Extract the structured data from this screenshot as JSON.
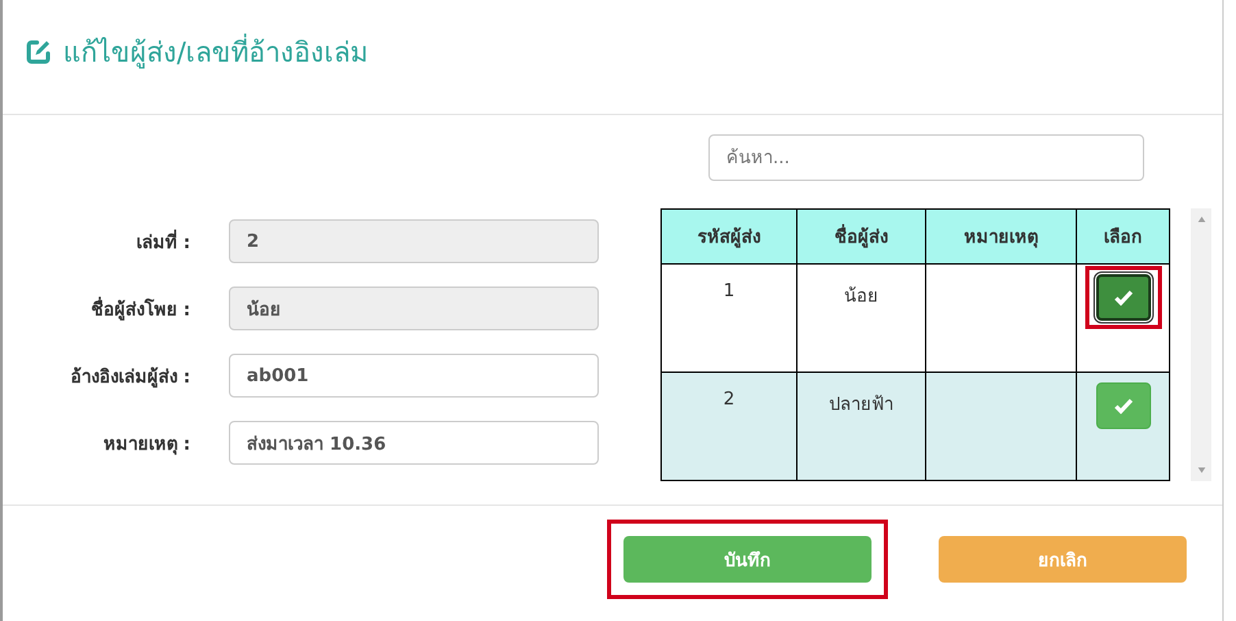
{
  "dialog": {
    "title": "แก้ไขผู้ส่ง/เลขที่อ้างอิงเล่ม"
  },
  "form": [
    {
      "label": "เล่มที่ :",
      "value": "2",
      "disabled": true
    },
    {
      "label": "ชื่อผู้ส่งโพย :",
      "value": "น้อย",
      "disabled": true
    },
    {
      "label": "อ้างอิงเล่มผู้ส่ง :",
      "value": "ab001",
      "disabled": false
    },
    {
      "label": "หมายเหตุ :",
      "value": "ส่งมาเวลา 10.36",
      "disabled": false
    }
  ],
  "search": {
    "placeholder": "ค้นหา..."
  },
  "table": {
    "columns": [
      "รหัสผู้ส่ง",
      "ชื่อผู้ส่ง",
      "หมายเหตุ",
      "เลือก"
    ],
    "rows": [
      {
        "code": "1",
        "name": "น้อย",
        "selected": true,
        "highlighted": true
      },
      {
        "code": "2",
        "name": "ปลายฟ้า",
        "selected": false,
        "highlighted": false
      }
    ]
  },
  "buttons": [
    {
      "kind": "save",
      "label": "บันทึก",
      "highlighted": true
    },
    {
      "kind": "cancel",
      "label": "ยกเลิก",
      "highlighted": false
    }
  ]
}
